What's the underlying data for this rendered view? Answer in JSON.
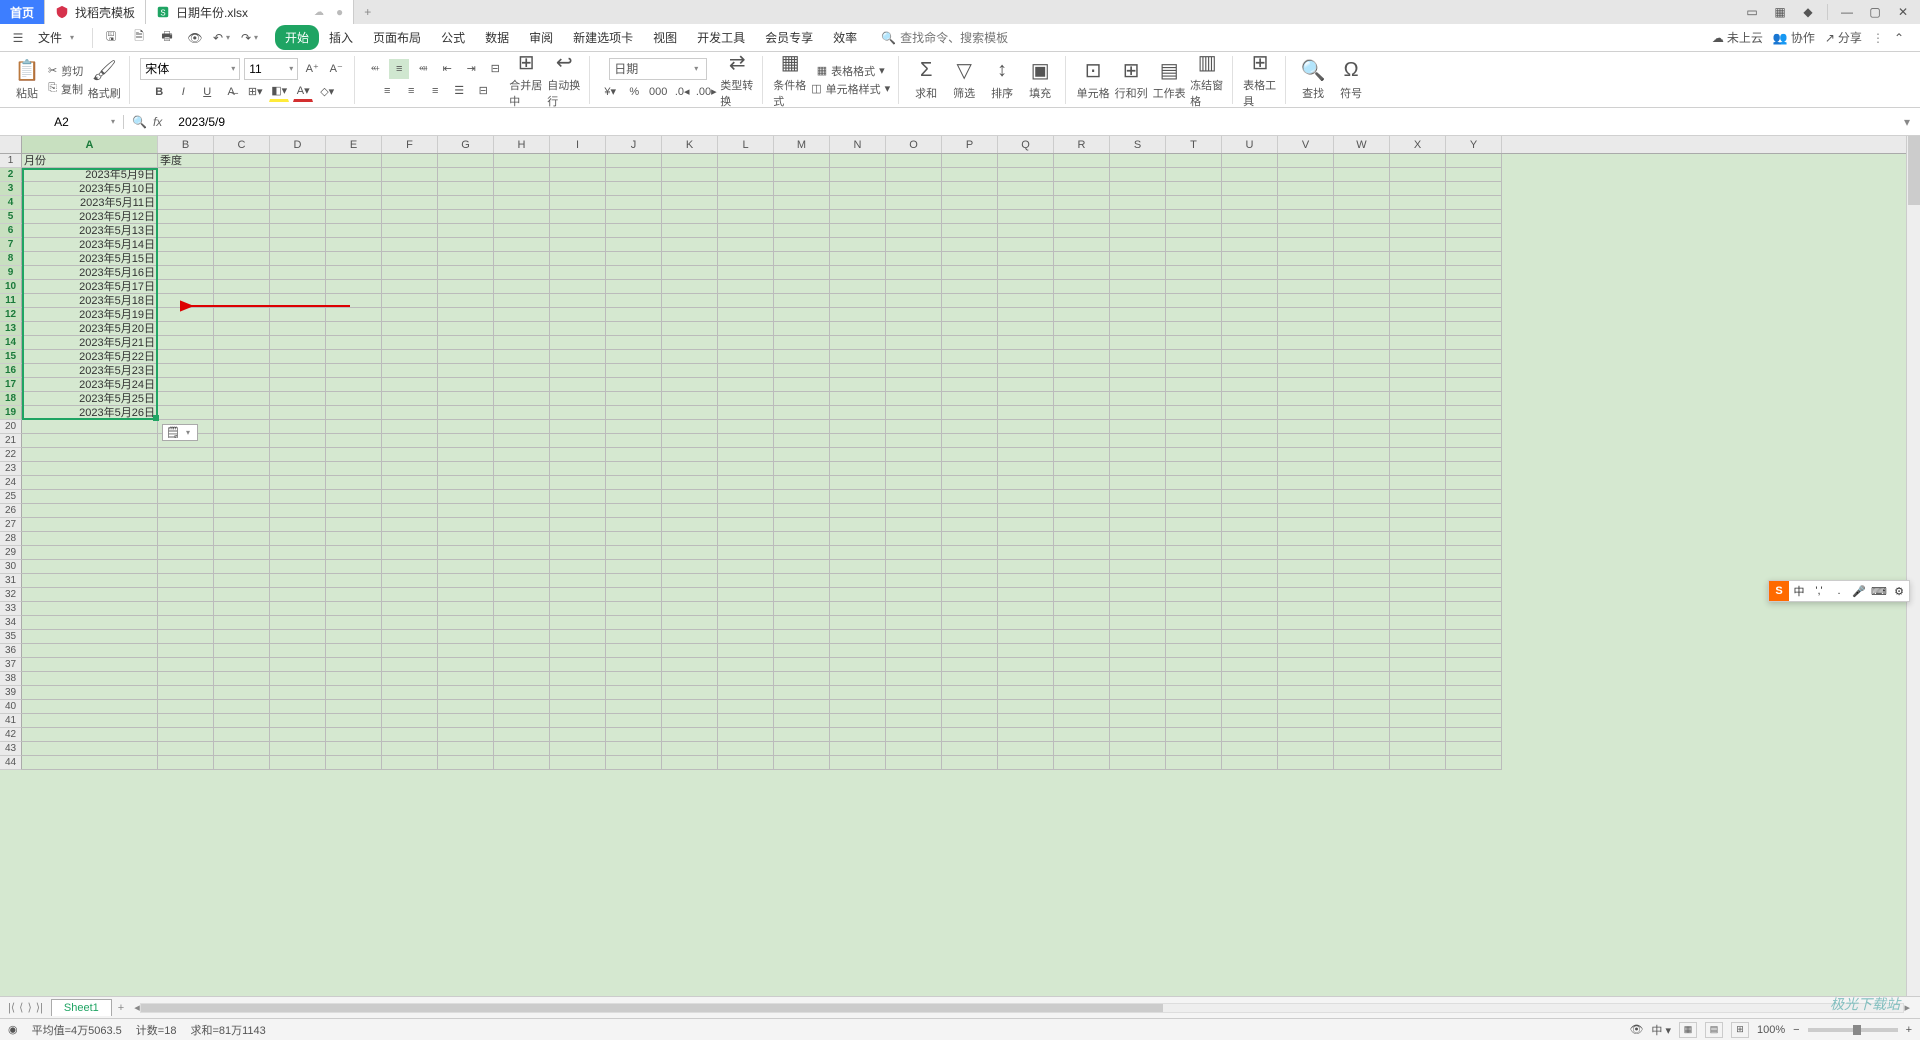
{
  "titlebar": {
    "home": "首页",
    "docer_tab": "找稻壳模板",
    "doc_tab": "日期年份.xlsx",
    "status_dot": "●",
    "add_tab": "+"
  },
  "menubar": {
    "file": "文件",
    "tabs": [
      "开始",
      "插入",
      "页面布局",
      "公式",
      "数据",
      "审阅",
      "新建选项卡",
      "视图",
      "开发工具",
      "会员专享",
      "效率"
    ],
    "active_tab_index": 0,
    "search_placeholder": "查找命令、搜索模板",
    "cloud": "未上云",
    "coop": "协作",
    "share": "分享"
  },
  "ribbon": {
    "paste": "粘贴",
    "cut": "剪切",
    "copy": "复制",
    "format_painter": "格式刷",
    "font_name": "宋体",
    "font_size": "11",
    "merge_center": "合并居中",
    "auto_wrap": "自动换行",
    "number_format": "日期",
    "type_convert": "类型转换",
    "cond_format": "条件格式",
    "table_style": "表格格式",
    "cell_style": "单元格样式",
    "sum": "求和",
    "filter": "筛选",
    "sort": "排序",
    "fill": "填充",
    "cell": "单元格",
    "row_col": "行和列",
    "sheet": "工作表",
    "freeze": "冻结窗格",
    "table_tools": "表格工具",
    "find": "查找",
    "symbol": "符号"
  },
  "formula": {
    "cell_ref": "A2",
    "fx_label": "fx",
    "value": "2023/5/9"
  },
  "grid": {
    "columns_first": "A",
    "columns": [
      "B",
      "C",
      "D",
      "E",
      "F",
      "G",
      "H",
      "I",
      "J",
      "K",
      "L",
      "M",
      "N",
      "O",
      "P",
      "Q",
      "R",
      "S",
      "T",
      "U",
      "V",
      "W",
      "X",
      "Y"
    ],
    "headers": {
      "A": "月份",
      "B": "季度"
    },
    "data_A": [
      "2023年5月9日",
      "2023年5月10日",
      "2023年5月11日",
      "2023年5月12日",
      "2023年5月13日",
      "2023年5月14日",
      "2023年5月15日",
      "2023年5月16日",
      "2023年5月17日",
      "2023年5月18日",
      "2023年5月19日",
      "2023年5月20日",
      "2023年5月21日",
      "2023年5月22日",
      "2023年5月23日",
      "2023年5月24日",
      "2023年5月25日",
      "2023年5月26日"
    ],
    "row_count": 44,
    "paste_options_label": "🗒"
  },
  "sheets": {
    "active": "Sheet1"
  },
  "status": {
    "avg": "平均值=4万5063.5",
    "count": "计数=18",
    "sum": "求和=81万1143",
    "zoom": "100%"
  },
  "ime": {
    "logo": "S",
    "items": [
      "中",
      "','",
      ".",
      "🎤",
      "⌨",
      "⚙"
    ]
  },
  "watermark": "极光下载站"
}
